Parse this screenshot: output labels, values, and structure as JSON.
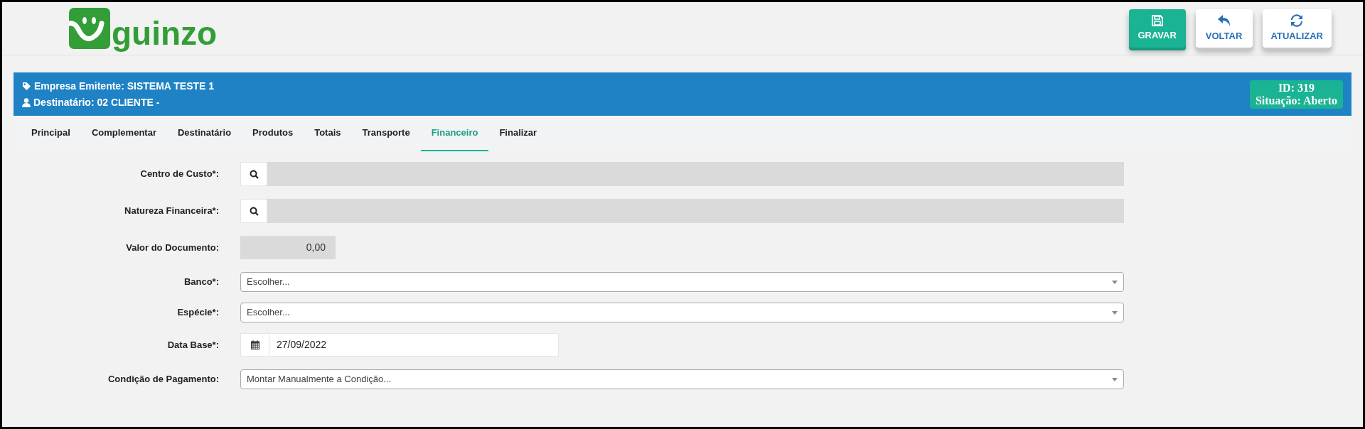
{
  "logo": {
    "text": "guinzo"
  },
  "toolbar": [
    {
      "label": "GRAVAR",
      "kind": "save",
      "primary": true
    },
    {
      "label": "VOLTAR",
      "kind": "back",
      "primary": false
    },
    {
      "label": "ATUALIZAR",
      "kind": "refresh",
      "primary": false
    }
  ],
  "header": {
    "issuer": "Empresa Emitente: SISTEMA TESTE 1",
    "recipient": "Destinatário: 02 CLIENTE -",
    "id": "ID: 319",
    "status": "Situação: Aberto"
  },
  "tabs": [
    {
      "label": "Principal",
      "selected": false
    },
    {
      "label": "Complementar",
      "selected": false
    },
    {
      "label": "Destinatário",
      "selected": false
    },
    {
      "label": "Produtos",
      "selected": false
    },
    {
      "label": "Totais",
      "selected": false
    },
    {
      "label": "Transporte",
      "selected": false
    },
    {
      "label": "Financeiro",
      "selected": true
    },
    {
      "label": "Finalizar",
      "selected": false
    }
  ],
  "form": [
    {
      "label": "Centro de Custo*:",
      "kind": "lookup"
    },
    {
      "label": "Natureza Financeira*:",
      "kind": "lookup"
    },
    {
      "label": "Valor do Documento:",
      "kind": "number",
      "value": "0,00"
    },
    {
      "label": "Banco*:",
      "kind": "select",
      "value": "Escolher..."
    },
    {
      "label": "Espécie*:",
      "kind": "select",
      "value": "Escolher..."
    },
    {
      "label": "Data Base*:",
      "kind": "date",
      "value": "27/09/2022"
    },
    {
      "label": "Condição de Pagamento:",
      "kind": "select",
      "value": "Montar Manualmente a Condição..."
    }
  ]
}
